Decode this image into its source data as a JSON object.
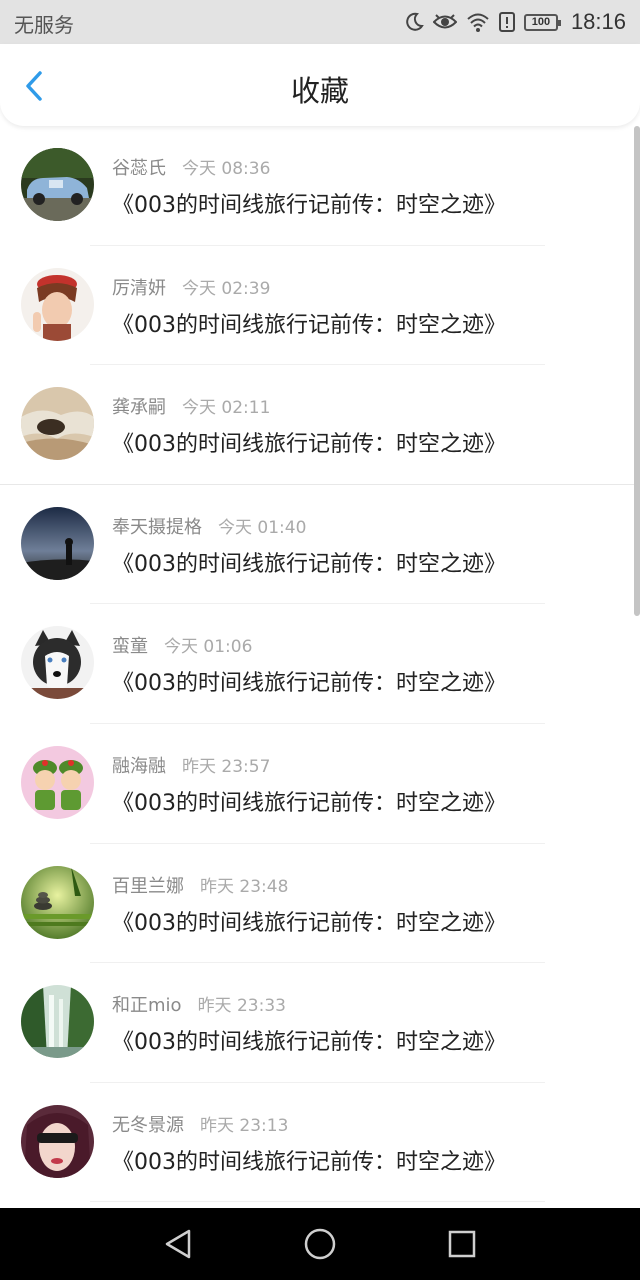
{
  "status_bar": {
    "carrier": "无服务",
    "battery": "100",
    "time": "18:16",
    "icons": [
      "moon-icon",
      "eye-icon",
      "wifi-icon",
      "alert-icon",
      "battery-icon"
    ]
  },
  "header": {
    "title": "收藏",
    "back_icon": "chevron-left-icon",
    "accent_color": "#2f9be9"
  },
  "favorites": [
    {
      "name": "谷蕊氏",
      "time": "今天 08:36",
      "title": "《003的时间线旅行记前传：时空之迹》",
      "avatar": "car-avatar"
    },
    {
      "name": "厉清妍",
      "time": "今天 02:39",
      "title": "《003的时间线旅行记前传：时空之迹》",
      "avatar": "anime-boy-avatar"
    },
    {
      "name": "龚承嗣",
      "time": "今天 02:11",
      "title": "《003的时间线旅行记前传：时空之迹》",
      "avatar": "hands-avatar"
    },
    {
      "name": "奉天摄提格",
      "time": "今天 01:40",
      "title": "《003的时间线旅行记前传：时空之迹》",
      "avatar": "night-sky-avatar"
    },
    {
      "name": "蛮童",
      "time": "今天 01:06",
      "title": "《003的时间线旅行记前传：时空之迹》",
      "avatar": "husky-avatar"
    },
    {
      "name": "融海融",
      "time": "昨天 23:57",
      "title": "《003的时间线旅行记前传：时空之迹》",
      "avatar": "cartoon-soldiers-avatar"
    },
    {
      "name": "百里兰娜",
      "time": "昨天 23:48",
      "title": "《003的时间线旅行记前传：时空之迹》",
      "avatar": "zen-stones-avatar"
    },
    {
      "name": "和正mio",
      "time": "昨天 23:33",
      "title": "《003的时间线旅行记前传：时空之迹》",
      "avatar": "waterfall-avatar"
    },
    {
      "name": "无冬景源",
      "time": "昨天 23:13",
      "title": "《003的时间线旅行记前传：时空之迹》",
      "avatar": "girl-sunglasses-avatar"
    }
  ],
  "nav_bar": {
    "back": "triangle-back-icon",
    "home": "circle-home-icon",
    "recents": "square-recents-icon"
  }
}
